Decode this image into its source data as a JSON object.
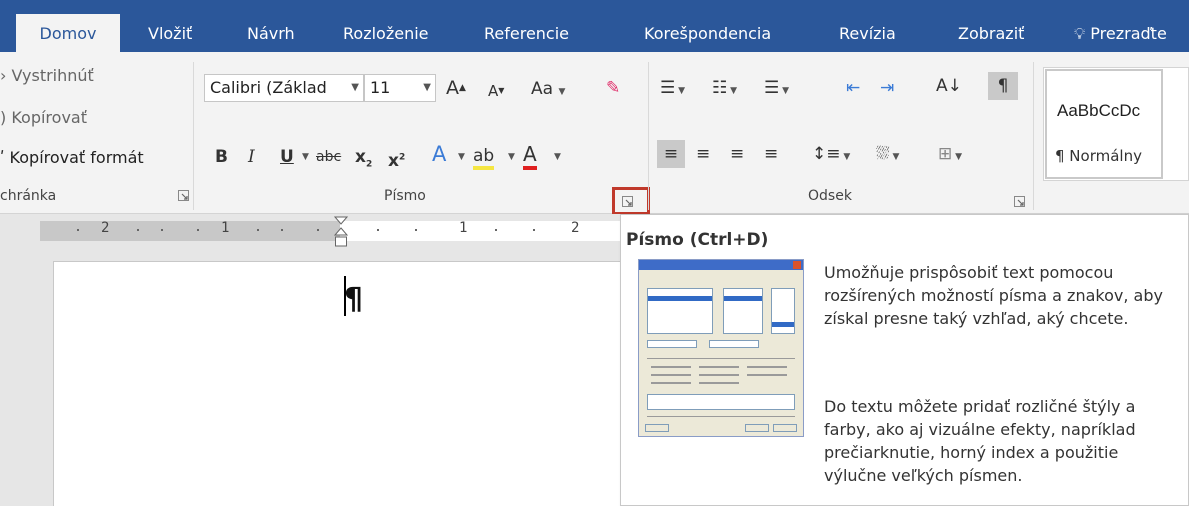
{
  "tabs": [
    {
      "label": "Domov",
      "active": true
    },
    {
      "label": "Vložiť"
    },
    {
      "label": "Návrh"
    },
    {
      "label": "Rozloženie"
    },
    {
      "label": "Referencie"
    },
    {
      "label": "Korešpondencia"
    },
    {
      "label": "Revízia"
    },
    {
      "label": "Zobraziť"
    },
    {
      "label": "Prezraďte"
    }
  ],
  "clipboard": {
    "cut": "Vystrihnúť",
    "copy": "Kopírovať",
    "format_painter": "Kopírovať formát",
    "group_label": "chránka"
  },
  "font_group": {
    "font_name": "Calibri (Základ",
    "font_size": "11",
    "change_case": "Aa",
    "group_label": "Písmo"
  },
  "paragraph_group": {
    "group_label": "Odsek"
  },
  "styles": {
    "sample": "AaBbCcDc",
    "name": "¶ Normálny"
  },
  "ruler": {
    "numbers": [
      "2",
      "1",
      "1",
      "2"
    ]
  },
  "document": {
    "pilcrow": "¶"
  },
  "tooltip": {
    "title": "Písmo (Ctrl+D)",
    "paragraph1": "Umožňuje prispôsobiť text pomocou rozšírených možností písma a znakov, aby získal presne taký vzhľad, aký chcete.",
    "paragraph2": "Do textu môžete pridať rozličné štýly a farby, ako aj vizuálne efekty, napríklad prečiarknutie, horný index a použitie výlučne veľkých písmen."
  },
  "colors": {
    "ribbon_blue": "#2b579a",
    "highlight_red": "#c0392b",
    "font_color_red": "#e02020"
  }
}
